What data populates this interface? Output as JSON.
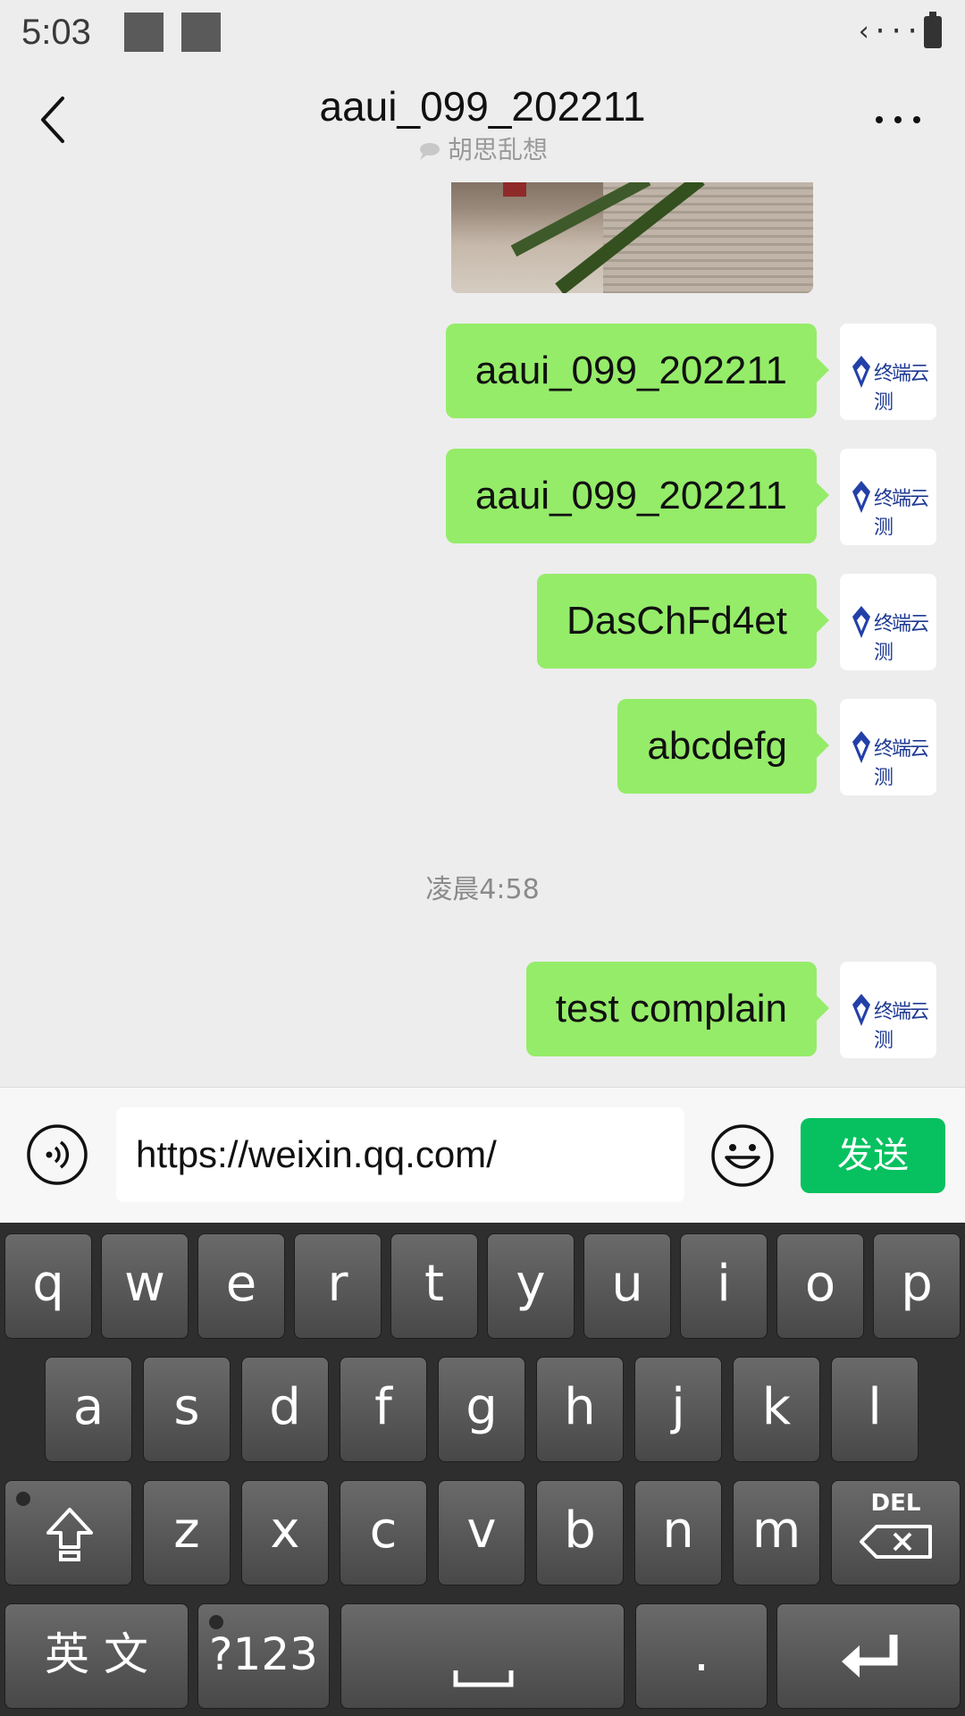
{
  "status_bar": {
    "time": "5:03",
    "connection": "‹···›"
  },
  "header": {
    "title": "aaui_099_202211",
    "subtitle": "胡思乱想"
  },
  "messages": [
    {
      "text": "aaui_099_202211",
      "avatar_text": "终端云测"
    },
    {
      "text": "aaui_099_202211",
      "avatar_text": "终端云测"
    },
    {
      "text": "DasChFd4et",
      "avatar_text": "终端云测"
    },
    {
      "text": "abcdefg",
      "avatar_text": "终端云测"
    },
    {
      "text": "test complain",
      "avatar_text": "终端云测"
    }
  ],
  "timestamp": "凌晨4:58",
  "input": {
    "value": "https://weixin.qq.com/",
    "send_label": "发送"
  },
  "keyboard": {
    "row1": [
      "q",
      "w",
      "e",
      "r",
      "t",
      "y",
      "u",
      "i",
      "o",
      "p"
    ],
    "row2": [
      "a",
      "s",
      "d",
      "f",
      "g",
      "h",
      "j",
      "k",
      "l"
    ],
    "row3": [
      "z",
      "x",
      "c",
      "v",
      "b",
      "n",
      "m"
    ],
    "del_label": "DEL",
    "lang_label": "英 文",
    "symbols_label": "?123",
    "period_label": "."
  },
  "colors": {
    "bubble": "#95ec69",
    "send": "#07c160",
    "background": "#ededed"
  }
}
